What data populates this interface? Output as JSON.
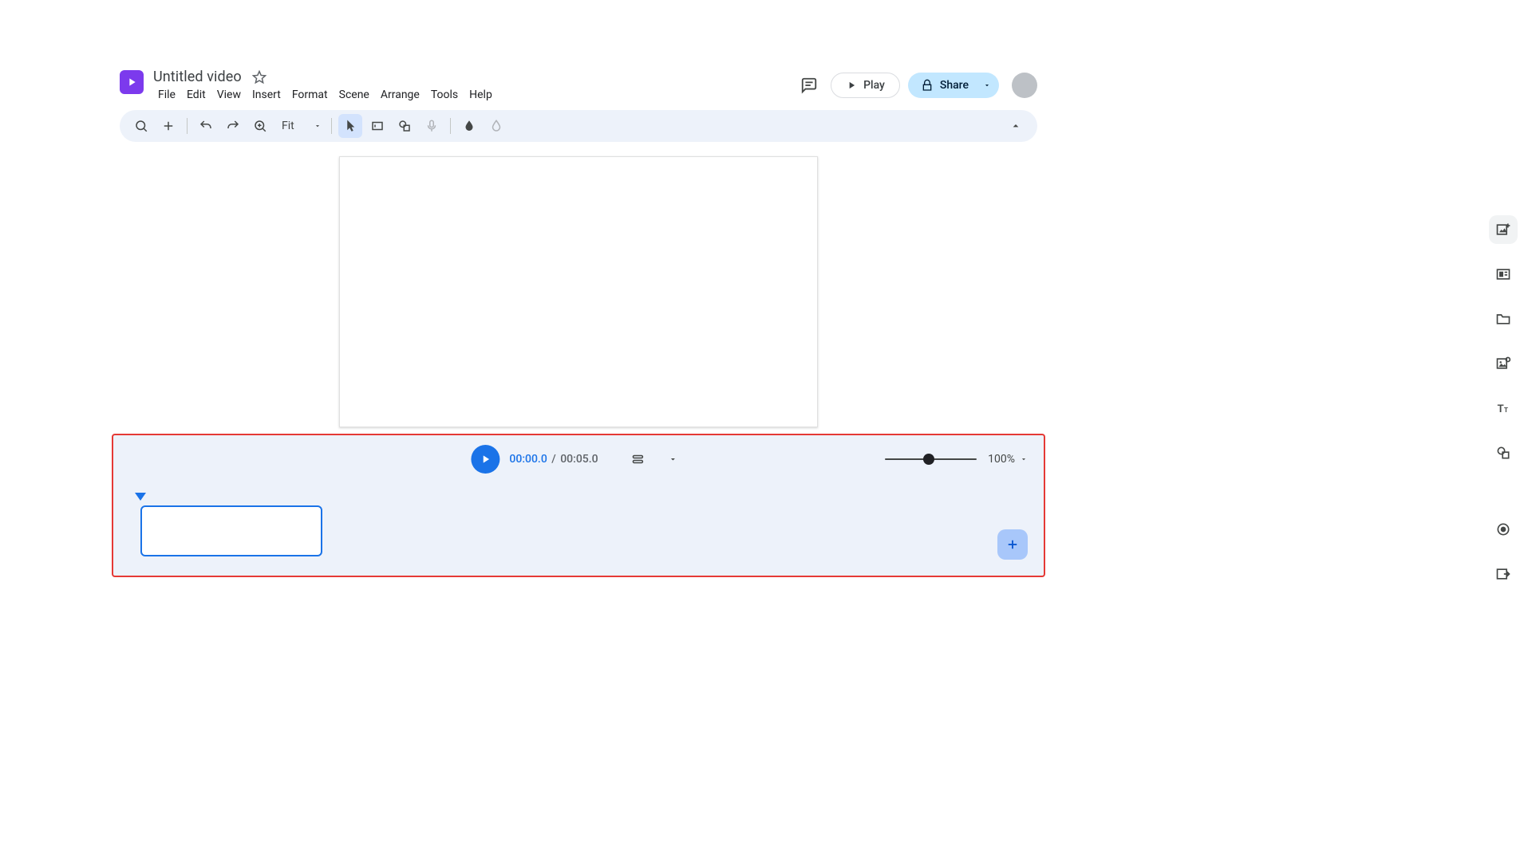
{
  "header": {
    "title": "Untitled video",
    "play_label": "Play",
    "share_label": "Share"
  },
  "menu": {
    "file": "File",
    "edit": "Edit",
    "view": "View",
    "insert": "Insert",
    "format": "Format",
    "scene": "Scene",
    "arrange": "Arrange",
    "tools": "Tools",
    "help": "Help"
  },
  "toolbar": {
    "zoom_mode": "Fit"
  },
  "timeline": {
    "current_time": "00:00.0",
    "separator": "/",
    "total_time": "00:05.0",
    "zoom_percent": "100%"
  }
}
